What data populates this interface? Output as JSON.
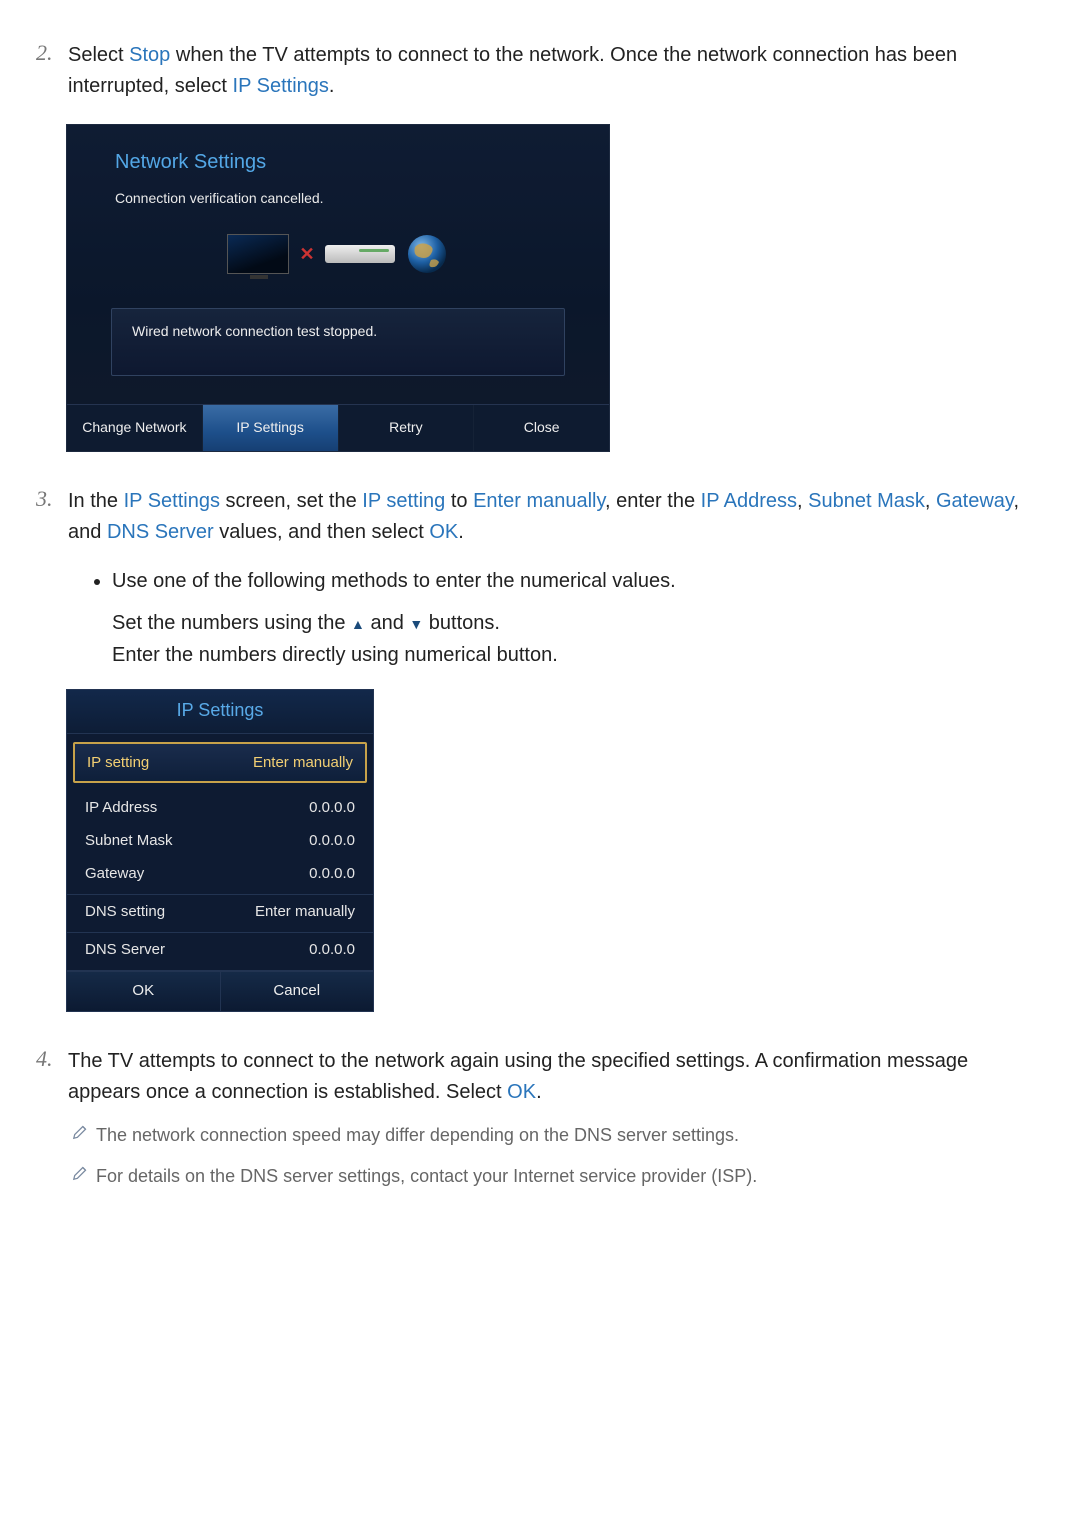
{
  "steps": {
    "s2": {
      "num": "2.",
      "pre1": "Select ",
      "stop": "Stop",
      "mid1": " when the TV attempts to connect to the network. Once the network connection has been interrupted, select ",
      "ipset": "IP Settings",
      "end1": "."
    },
    "s3": {
      "num": "3.",
      "a": "In the ",
      "ip_settings": "IP Settings",
      "b": " screen, set the ",
      "ip_setting": "IP setting",
      "c": " to ",
      "enter_manually": "Enter manually",
      "d": ", enter the ",
      "ip_address": "IP Address",
      "e": ", ",
      "subnet_mask": "Subnet Mask",
      "f": ", ",
      "gateway": "Gateway",
      "g": ", and ",
      "dns_server": "DNS Server",
      "h": " values, and then select ",
      "ok": "OK",
      "i": ".",
      "bullet": "Use one of the following methods to enter the numerical values.",
      "line1a": "Set the numbers using the ",
      "line1b": " and ",
      "line1c": " buttons.",
      "line2": "Enter the numbers directly using numerical button."
    },
    "s4": {
      "num": "4.",
      "a": "The TV attempts to connect to the network again using the specified settings. A confirmation message appears once a connection is established. Select ",
      "ok": "OK",
      "b": ".",
      "note1": "The network connection speed may differ depending on the DNS server settings.",
      "note2": "For details on the DNS server settings, contact your Internet service provider (ISP)."
    }
  },
  "net_dialog": {
    "title": "Network Settings",
    "subtitle": "Connection verification cancelled.",
    "stopped": "Wired network connection test stopped.",
    "buttons": {
      "change": "Change Network",
      "ip": "IP Settings",
      "retry": "Retry",
      "close": "Close"
    }
  },
  "ip_dialog": {
    "title": "IP Settings",
    "rows": {
      "ip_setting_k": "IP setting",
      "ip_setting_v": "Enter manually",
      "ip_address_k": "IP Address",
      "ip_address_v": "0.0.0.0",
      "subnet_k": "Subnet Mask",
      "subnet_v": "0.0.0.0",
      "gateway_k": "Gateway",
      "gateway_v": "0.0.0.0",
      "dns_setting_k": "DNS setting",
      "dns_setting_v": "Enter manually",
      "dns_server_k": "DNS Server",
      "dns_server_v": "0.0.0.0"
    },
    "ok": "OK",
    "cancel": "Cancel"
  }
}
